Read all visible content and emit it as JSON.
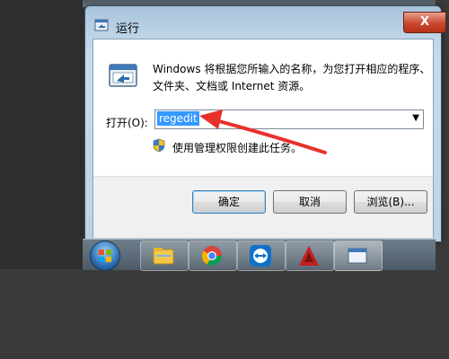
{
  "window": {
    "title": "运行",
    "close_glyph": "X"
  },
  "dialog": {
    "description_line1": "Windows 将根据您所输入的名称，为您打开相应的程序、",
    "description_line2": "文件夹、文档或 Internet 资源。",
    "open_label": "打开(O):",
    "open_value": "regedit",
    "admin_note": "使用管理权限创建此任务。",
    "run_icon": "run-program-icon",
    "shield_icon": "uac-shield-icon"
  },
  "buttons": {
    "ok": "确定",
    "cancel": "取消",
    "browse": "浏览(B)..."
  },
  "taskbar": {
    "items": [
      "file-explorer-icon",
      "chrome-icon",
      "teamviewer-icon",
      "autocad-icon",
      "run-window-icon"
    ]
  },
  "colors": {
    "selection": "#3399ff",
    "annotation_arrow": "#e8302a",
    "close_button": "#c8492f"
  }
}
